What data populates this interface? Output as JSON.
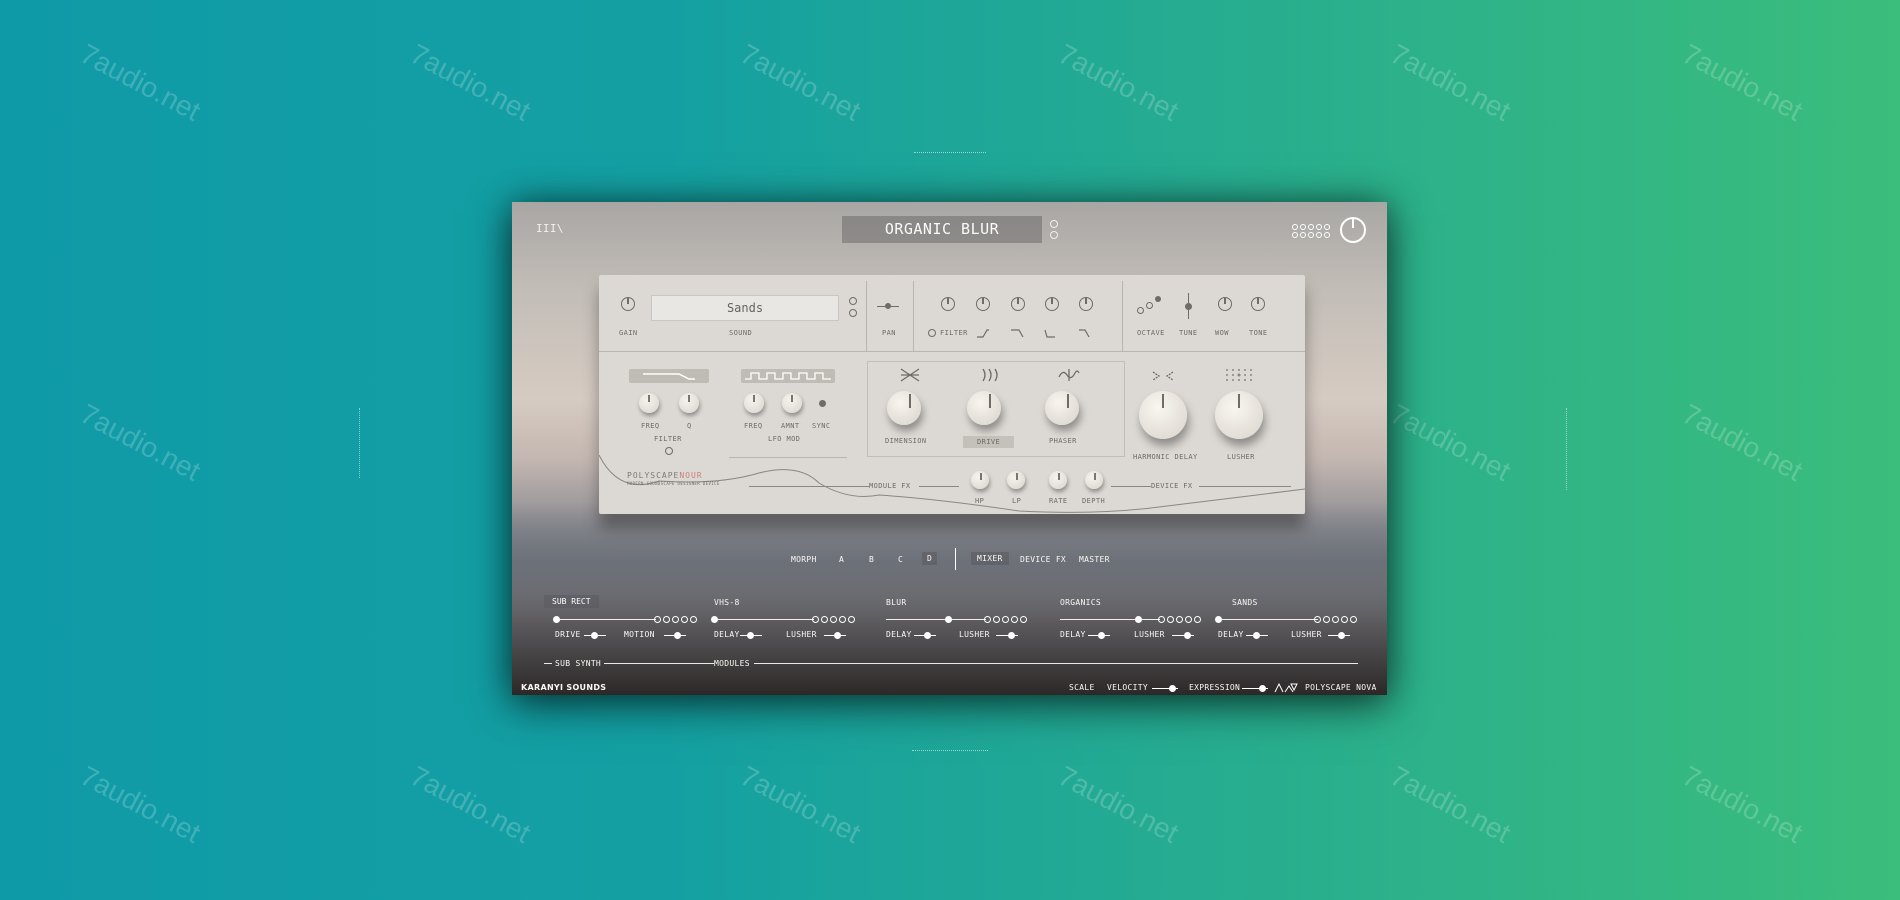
{
  "watermark": "7audio.net",
  "header": {
    "logo": "III\\",
    "preset": "ORGANIC BLUR"
  },
  "sound_section": {
    "gain": "GAIN",
    "sound_label": "SOUND",
    "sound_value": "Sands",
    "pan": "PAN",
    "filter": "FILTER",
    "octave": "OCTAVE",
    "tune": "TUNE",
    "wow": "WOW",
    "tone": "TONE"
  },
  "filter_section": {
    "freq": "FREQ",
    "q": "Q",
    "title": "FILTER"
  },
  "lfo_section": {
    "freq": "FREQ",
    "amnt": "AMNT",
    "sync": "SYNC",
    "title": "LFO MOD"
  },
  "module_fx": {
    "dimension": "DIMENSION",
    "drive": "DRIVE",
    "phaser": "PHASER",
    "title": "MODULE FX",
    "hp": "HP",
    "lp": "LP",
    "rate": "RATE",
    "depth": "DEPTH"
  },
  "device_fx": {
    "harmonic_delay": "HARMONIC DELAY",
    "lusher": "LUSHER",
    "title": "DEVICE FX"
  },
  "brand": {
    "product": "POLYSCAPE NOUR",
    "product_accent": "NOUR",
    "product_main": "POLYSCAPE",
    "tagline": "MODERN SOUNDSCAPE DESIGNER DEVICE"
  },
  "morph": {
    "label": "MORPH",
    "slots": [
      "A",
      "B",
      "C",
      "D"
    ],
    "active": "D"
  },
  "pages": {
    "mixer": "MIXER",
    "device_fx": "DEVICE FX",
    "master": "MASTER",
    "active": "MIXER"
  },
  "channels": [
    {
      "name": "SUB RECT",
      "p1": "DRIVE",
      "p2": "MOTION",
      "level": 0
    },
    {
      "name": "VHS-8",
      "p1": "DELAY",
      "p2": "LUSHER",
      "level": 0
    },
    {
      "name": "BLUR",
      "p1": "DELAY",
      "p2": "LUSHER",
      "level": 0.62
    },
    {
      "name": "ORGANICS",
      "p1": "DELAY",
      "p2": "LUSHER",
      "level": 0.78
    },
    {
      "name": "SANDS",
      "p1": "DELAY",
      "p2": "LUSHER",
      "level": 0
    }
  ],
  "footer": {
    "sub_synth": "SUB SYNTH",
    "modules": "MODULES",
    "company": "KARANYI SOUNDS",
    "scale": "SCALE",
    "velocity": "VELOCITY",
    "expression": "EXPRESSION",
    "product": "POLYSCAPE NOVA"
  }
}
